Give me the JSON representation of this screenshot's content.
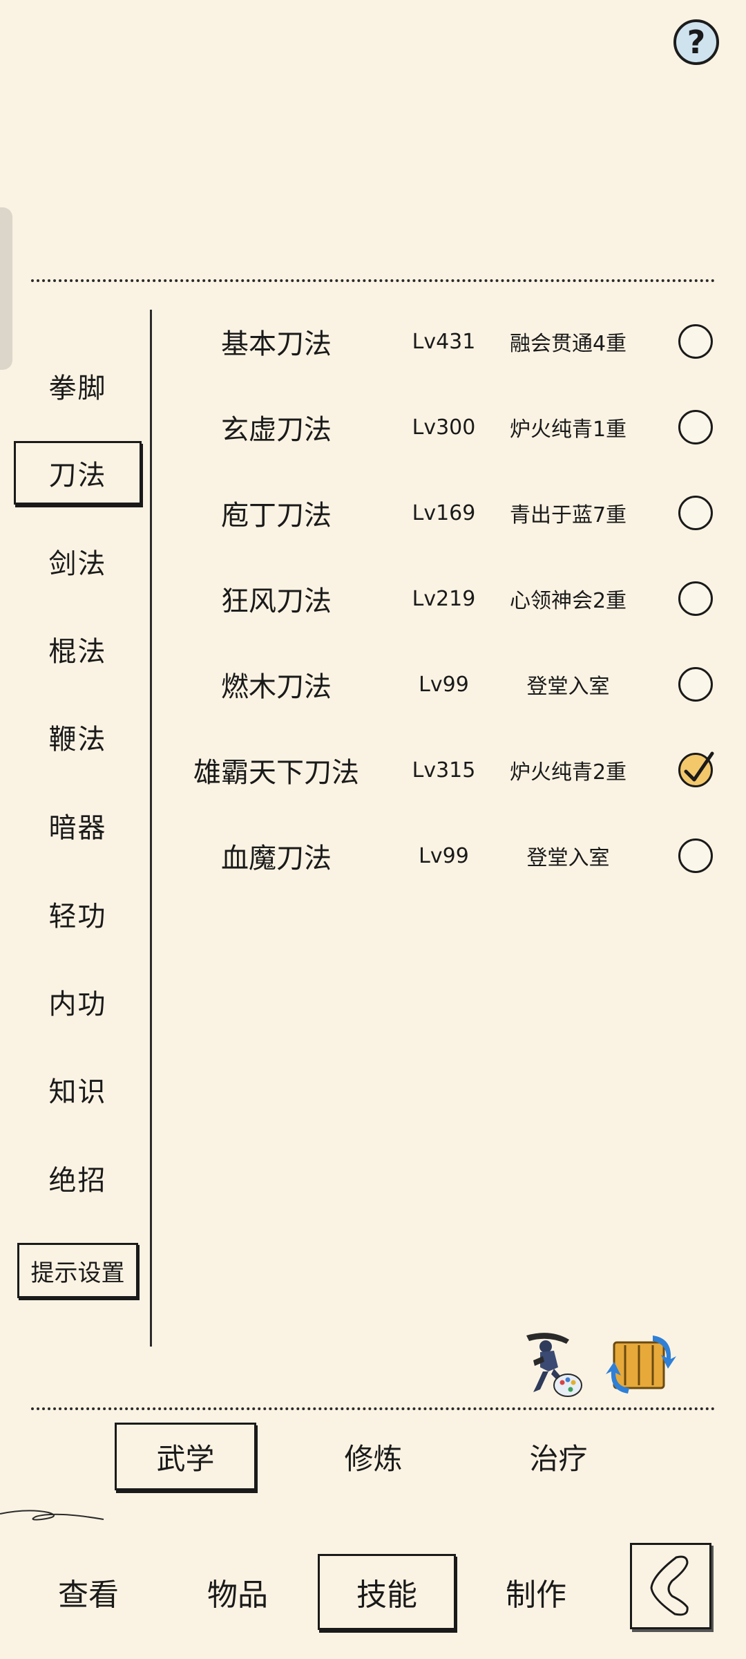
{
  "help": {
    "label": "?"
  },
  "categories": [
    {
      "label": "拳脚"
    },
    {
      "label": "刀法"
    },
    {
      "label": "剑法"
    },
    {
      "label": "棍法"
    },
    {
      "label": "鞭法"
    },
    {
      "label": "暗器"
    },
    {
      "label": "轻功"
    },
    {
      "label": "内功"
    },
    {
      "label": "知识"
    },
    {
      "label": "绝招"
    }
  ],
  "selected_category": "刀法",
  "hint_settings": {
    "label": "提示设置"
  },
  "skills": [
    {
      "name": "基本刀法",
      "level": "Lv431",
      "rank": "融会贯通4重",
      "checked": false
    },
    {
      "name": "玄虚刀法",
      "level": "Lv300",
      "rank": "炉火纯青1重",
      "checked": false
    },
    {
      "name": "庖丁刀法",
      "level": "Lv169",
      "rank": "青出于蓝7重",
      "checked": false
    },
    {
      "name": "狂风刀法",
      "level": "Lv219",
      "rank": "心领神会2重",
      "checked": false
    },
    {
      "name": "燃木刀法",
      "level": "Lv99",
      "rank": "登堂入室",
      "checked": false
    },
    {
      "name": "雄霸天下刀法",
      "level": "Lv315",
      "rank": "炉火纯青2重",
      "checked": true
    },
    {
      "name": "血魔刀法",
      "level": "Lv99",
      "rank": "登堂入室",
      "checked": false
    }
  ],
  "action_icons": [
    {
      "icon": "martial-artist-icon"
    },
    {
      "icon": "scroll-swap-icon"
    }
  ],
  "sub_tabs": [
    {
      "label": "武学",
      "selected": true
    },
    {
      "label": "修炼",
      "selected": false
    },
    {
      "label": "治疗",
      "selected": false
    }
  ],
  "nav": [
    {
      "label": "查看",
      "selected": false
    },
    {
      "label": "物品",
      "selected": false
    },
    {
      "label": "技能",
      "selected": true
    },
    {
      "label": "制作",
      "selected": false
    }
  ],
  "back": {
    "icon": "back-chevron-icon"
  }
}
